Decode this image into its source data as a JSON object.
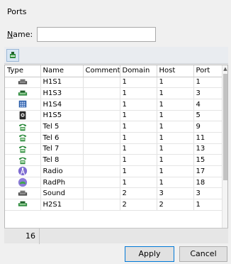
{
  "window": {
    "title": "Ports"
  },
  "name_field": {
    "label_accel": "N",
    "label_rest": "ame:",
    "value": ""
  },
  "toolbar": {
    "add_icon": "device-add-icon"
  },
  "table": {
    "columns": [
      "Type",
      "Name",
      "Comment",
      "Domain",
      "Host",
      "Port"
    ],
    "rows": [
      {
        "icon": "analog-phone-icon",
        "name": "H1S1",
        "comment": "",
        "domain": "1",
        "host": "1",
        "port": "1"
      },
      {
        "icon": "analog-phone-green-icon",
        "name": "H1S3",
        "comment": "",
        "domain": "1",
        "host": "1",
        "port": "3"
      },
      {
        "icon": "keypad-icon",
        "name": "H1S4",
        "comment": "",
        "domain": "1",
        "host": "1",
        "port": "4"
      },
      {
        "icon": "digital-phone-icon",
        "name": "H1S5",
        "comment": "",
        "domain": "1",
        "host": "1",
        "port": "5"
      },
      {
        "icon": "telephone-icon",
        "name": "Tel 5",
        "comment": "",
        "domain": "1",
        "host": "1",
        "port": "9"
      },
      {
        "icon": "telephone-icon",
        "name": "Tel 6",
        "comment": "",
        "domain": "1",
        "host": "1",
        "port": "11"
      },
      {
        "icon": "telephone-icon",
        "name": "Tel 7",
        "comment": "",
        "domain": "1",
        "host": "1",
        "port": "13"
      },
      {
        "icon": "telephone-icon",
        "name": "Tel 8",
        "comment": "",
        "domain": "1",
        "host": "1",
        "port": "15"
      },
      {
        "icon": "radio-tower-icon",
        "name": "Radio",
        "comment": "",
        "domain": "1",
        "host": "1",
        "port": "17"
      },
      {
        "icon": "radio-phone-icon",
        "name": "RadPh",
        "comment": "",
        "domain": "1",
        "host": "1",
        "port": "18"
      },
      {
        "icon": "analog-phone-icon",
        "name": "Sound",
        "comment": "",
        "domain": "2",
        "host": "3",
        "port": "3"
      },
      {
        "icon": "analog-phone-green-icon",
        "name": "H2S1",
        "comment": "",
        "domain": "2",
        "host": "2",
        "port": "1"
      }
    ],
    "row_count": "16"
  },
  "buttons": {
    "apply": "Apply",
    "cancel": "Cancel"
  },
  "colors": {
    "accent": "#0078d7",
    "phone_green": "#2e8b3e"
  }
}
